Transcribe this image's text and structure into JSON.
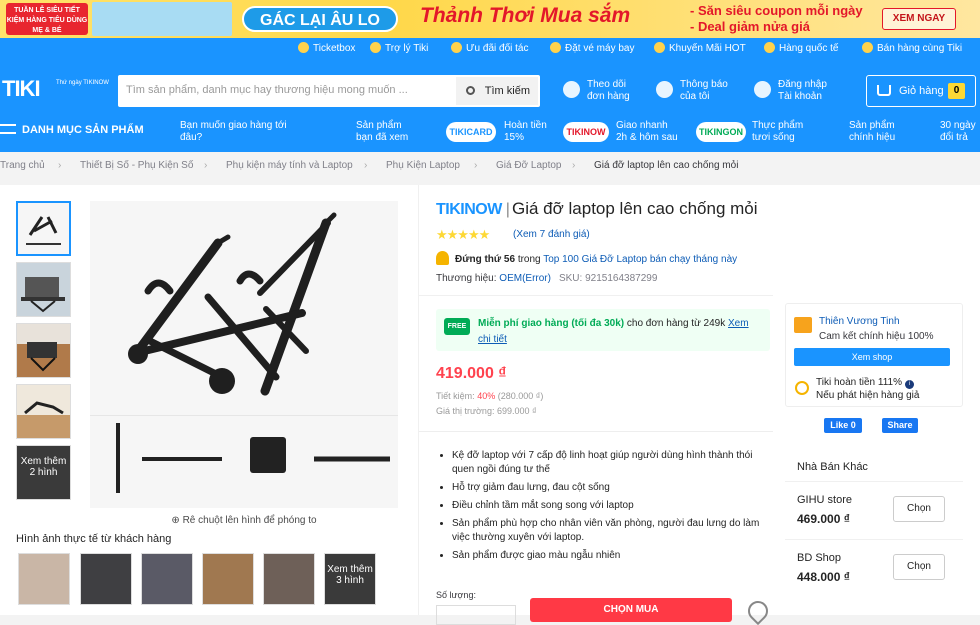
{
  "banner": {
    "badge": "TUẦN LỄ SIÊU TIẾT KIỆM HÀNG TIÊU DÙNG MẸ & BÉ",
    "pill": "GÁC LẠI ÂU LO",
    "headline": "Thảnh Thơi Mua sắm",
    "line1": "- Săn siêu coupon mỗi ngày",
    "line2": "- Deal giảm nửa giá",
    "button": "XEM NGAY"
  },
  "toplinks": [
    "Ticketbox",
    "Trợ lý Tiki",
    "Ưu đãi đối tác",
    "Đặt vé máy bay",
    "Khuyến Mãi HOT",
    "Hàng quốc tế",
    "Bán hàng cùng Tiki"
  ],
  "header": {
    "logo": "TIKI",
    "logo_sub": "Thứ ngày TIKINOW",
    "search_placeholder": "Tìm sản phẩm, danh mục hay thương hiệu mong muốn ...",
    "search_button": "Tìm kiếm",
    "track_l1": "Theo dõi",
    "track_l2": "đơn hàng",
    "notif_l1": "Thông báo",
    "notif_l2": "của tôi",
    "login_l1": "Đăng nhập",
    "login_l2": "Tài khoản",
    "cart_label": "Giỏ hàng",
    "cart_count": "0"
  },
  "nav": {
    "category": "DANH MỤC SẢN PHẨM",
    "deliver_l1": "Bạn muốn giao hàng tới",
    "deliver_l2": "đâu?",
    "viewed_l1": "Sản phẩm",
    "viewed_l2": "bạn đã xem",
    "tikicard": "TIKICARD",
    "card_l1": "Hoàn tiền",
    "card_l2": "15%",
    "tikinow": "TIKINOW",
    "now_l1": "Giao nhanh",
    "now_l2": "2h & hôm sau",
    "tikingon": "TIKINGON",
    "ngon_l1": "Thực phẩm",
    "ngon_l2": "tươi sống",
    "genuine_l1": "Sản phẩm",
    "genuine_l2": "chính hiệu",
    "return_l1": "30 ngày",
    "return_l2": "đổi trả"
  },
  "breadcrumb": [
    "Trang chủ",
    "Thiết Bị Số - Phụ Kiện Số",
    "Phụ kiện máy tính và Laptop",
    "Phụ Kiện Laptop",
    "Giá Đỡ Laptop",
    "Giá đỡ laptop lên cao chống mỏi"
  ],
  "gallery": {
    "more_label": "Xem thêm 2 hình",
    "zoom_hint": "Rê chuột lên hình để phóng to",
    "customer_title": "Hình ảnh thực tế từ khách hàng",
    "customer_more": "Xem thêm 3 hình"
  },
  "product": {
    "badge": "TIKINOW",
    "title": "Giá đỡ laptop lên cao chống mỏi",
    "rating": 5,
    "review_link": "(Xem 7 đánh giá)",
    "rank_bold": "Đứng thứ 56",
    "rank_mid": " trong ",
    "rank_link": "Top 100 Giá Đỡ Laptop bán chạy tháng này",
    "brand_label": "Thương hiệu: ",
    "brand": "OEM(Error)",
    "sku": "SKU: 9215164387299",
    "ship_bold": "Miễn phí giao hàng (tối đa 30k)",
    "ship_rest": " cho đơn hàng từ 249k ",
    "ship_link": "Xem chi tiết",
    "price": "419.000 ₫",
    "save_label": "Tiết kiệm: ",
    "save_pct": "40%",
    "save_amt": " (280.000 ₫)",
    "market": "Giá thị trường: 699.000 ₫",
    "features": [
      "Kệ đỡ laptop với 7 cấp độ linh hoạt giúp người dùng hình thành thói quen ngồi đúng tư thế",
      "Hỗ trợ giảm đau lưng, đau cột sống",
      "Điều chỉnh tầm mắt song song với laptop",
      "Sản phẩm phù hợp cho nhân viên văn phòng, người đau lưng do làm việc thường xuyên với laptop.",
      "Sản phẩm được giao màu ngẫu nhiên"
    ],
    "qty_label": "Số lượng:",
    "buy_button": "CHỌN MUA"
  },
  "seller": {
    "name": "Thiên Vương Tinh",
    "genuine": "Cam kết chính hiệu 100%",
    "view_shop": "Xem shop",
    "refund_l1": "Tiki hoàn tiền 111%",
    "refund_l2": "Nếu phát hiện hàng giả",
    "like": "Like 0",
    "share": "Share"
  },
  "others": {
    "title": "Nhà Bán Khác",
    "sellers": [
      {
        "name": "GIHU store",
        "price": "469.000 ₫",
        "btn": "Chọn"
      },
      {
        "name": "BD Shop",
        "price": "448.000 ₫",
        "btn": "Chọn"
      }
    ]
  },
  "colors": {
    "primary": "#1a94ff",
    "price": "#ff424e",
    "link": "#0d5cb6",
    "green": "#00ab56"
  }
}
